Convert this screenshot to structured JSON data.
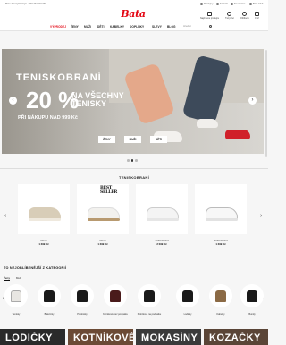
{
  "topbar": {
    "phone": "Máte dotazy? Volejte +420 272 010 093",
    "links": [
      "Prodejny",
      "Kontakt",
      "Newsletter",
      "Bata Club"
    ]
  },
  "header": {
    "logo": "Bata",
    "icons": [
      {
        "icon": "store-icon",
        "label": "Najdi svou prodejnu"
      },
      {
        "icon": "user-icon",
        "label": "Tvůj účet"
      },
      {
        "icon": "heart-icon",
        "label": "Oblíbené"
      },
      {
        "icon": "cart-icon",
        "label": "0 Kč"
      }
    ]
  },
  "nav": {
    "items": [
      "VÝPRODEJ",
      "ŽENY",
      "MUŽI",
      "DĚTI",
      "KABELKY",
      "DOPLŇKY",
      "SLEVY",
      "BLOG"
    ],
    "search_placeholder": "Hledat"
  },
  "hero": {
    "title": "TENISKOBRANÍ",
    "percent": "20 %",
    "subtitle": "NA VŠECHNY TENISKY",
    "condition": "PŘI NÁKUPU NAD 999 Kč",
    "buttons": [
      "ŽENY",
      "MUŽI",
      "DĚTI"
    ],
    "slides": 3,
    "active_slide": 2
  },
  "products": {
    "title": "TENISKOBRANÍ",
    "badge": "BEST SELLER",
    "items": [
      {
        "brand": "BATA",
        "price": "1 299 Kč",
        "color": "#d8cdb8",
        "sole": "#efe9de"
      },
      {
        "brand": "BATA",
        "price": "1 299 Kč",
        "color": "#f2f1ee",
        "sole": "#b89a70"
      },
      {
        "brand": "SKECHERS",
        "price": "2 099 Kč",
        "color": "#f4f4f4",
        "sole": "#e6e6e6"
      },
      {
        "brand": "SKECHERS",
        "price": "1 299 Kč",
        "color": "#f7f7f7",
        "sole": "#e2e2e2"
      }
    ]
  },
  "categories": {
    "title": "TO NEJOBLÍBENĚJŠÍ Z KATEGORIÍ",
    "tabs": [
      "Ženy",
      "Muži"
    ],
    "active_tab": "Ženy",
    "items": [
      {
        "label": "Tenisky",
        "tone": "white"
      },
      {
        "label": "Balerínky",
        "tone": "black"
      },
      {
        "label": "Polobotky",
        "tone": "black"
      },
      {
        "label": "Kotníková bez podpatku",
        "tone": "wine"
      },
      {
        "label": "Kotníková na podpatku",
        "tone": "black"
      },
      {
        "label": "Lodičky",
        "tone": "black"
      },
      {
        "label": "Kabelky",
        "tone": "tan"
      },
      {
        "label": "Bundy",
        "tone": "black"
      }
    ]
  },
  "banners": [
    {
      "label": "LODIČKY",
      "color": "#2a2a2a"
    },
    {
      "label": "KOTNÍKOVÉ",
      "color": "#6b4a35"
    },
    {
      "label": "MOKASÍNY",
      "color": "#3a3a3a"
    },
    {
      "label": "KOZAČKY",
      "color": "#5a4537"
    }
  ]
}
